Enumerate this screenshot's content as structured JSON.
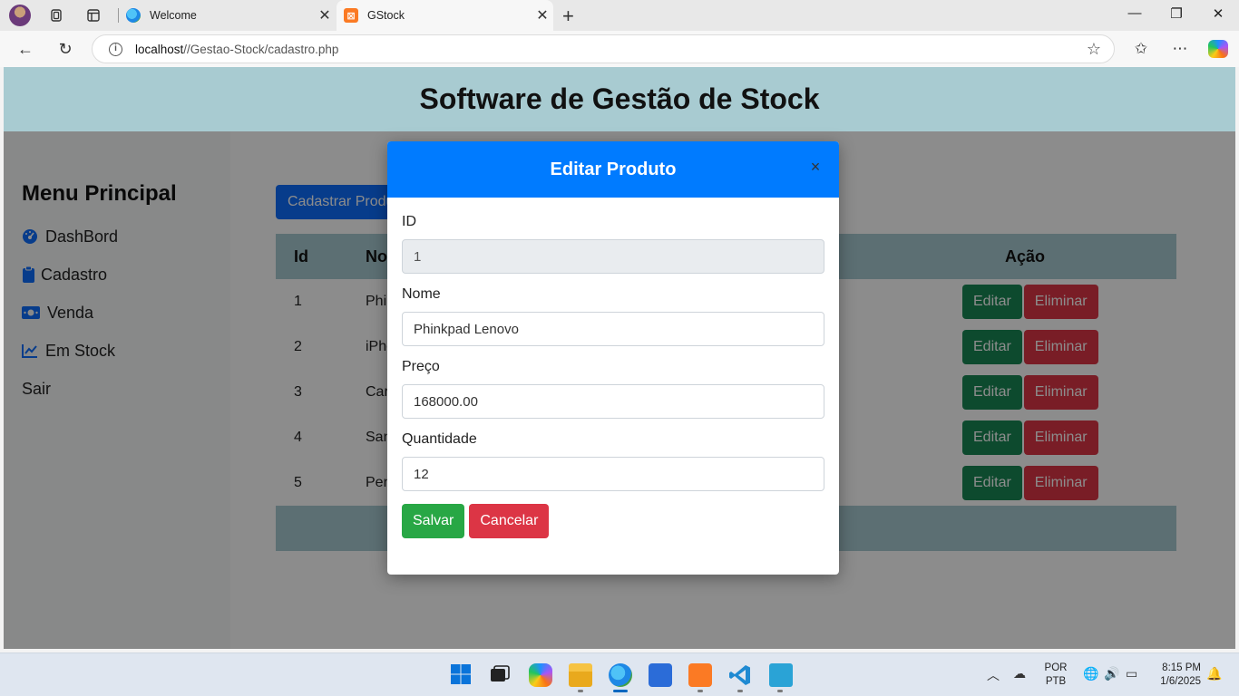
{
  "browser": {
    "tabs": [
      {
        "title": "Welcome",
        "active": false
      },
      {
        "title": "GStock",
        "active": true
      }
    ],
    "url_host": "localhost",
    "url_path": "//Gestao-Stock/cadastro.php",
    "icons": [
      "profile-avatar",
      "workspaces-icon",
      "tab-actions-icon",
      "back-icon",
      "refresh-icon",
      "site-info-icon",
      "favorite-star-icon",
      "favorites-icon",
      "more-icon",
      "copilot-icon"
    ]
  },
  "page": {
    "header_title": "Software de Gestão de Stock",
    "sidebar": {
      "title": "Menu Principal",
      "items": [
        {
          "label": "DashBord",
          "icon": "dashboard-icon"
        },
        {
          "label": "Cadastro",
          "icon": "clipboard-icon"
        },
        {
          "label": "Venda",
          "icon": "money-icon"
        },
        {
          "label": "Em Stock",
          "icon": "chart-line-icon"
        },
        {
          "label": "Sair",
          "icon": ""
        }
      ]
    },
    "register_button": "Cadastrar Produ",
    "table": {
      "headers": {
        "id": "Id",
        "nome": "No",
        "acao": "Ação"
      },
      "rows": [
        {
          "id": "1",
          "nome": "Phi"
        },
        {
          "id": "2",
          "nome": "iPho"
        },
        {
          "id": "3",
          "nome": "Car"
        },
        {
          "id": "4",
          "nome": "San"
        },
        {
          "id": "5",
          "nome": "Pen"
        }
      ],
      "edit_label": "Editar",
      "delete_label": "Eliminar"
    }
  },
  "modal": {
    "title": "Editar Produto",
    "close_symbol": "×",
    "fields": {
      "id": {
        "label": "ID",
        "value": "1"
      },
      "nome": {
        "label": "Nome",
        "value": "Phinkpad Lenovo"
      },
      "preco": {
        "label": "Preço",
        "value": "168000.00"
      },
      "quantidade": {
        "label": "Quantidade",
        "value": "12"
      }
    },
    "save_label": "Salvar",
    "cancel_label": "Cancelar"
  },
  "taskbar": {
    "lang_top": "POR",
    "lang_bottom": "PTB",
    "time": "8:15 PM",
    "date": "1/6/2025"
  },
  "colors": {
    "header": "#a8cbd1",
    "modal_header": "#007bff",
    "primary": "#0d6efd",
    "success": "#198754",
    "danger": "#dc3545"
  }
}
